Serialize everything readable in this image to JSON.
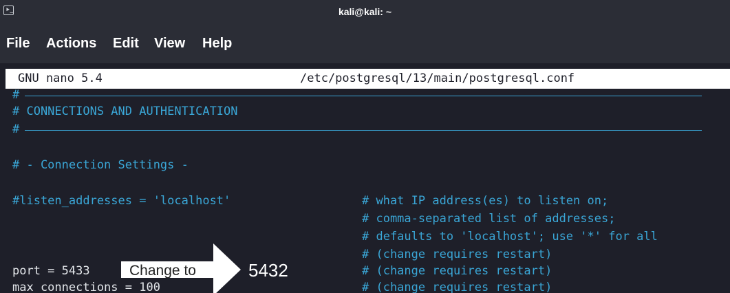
{
  "window": {
    "title": "kali@kali: ~",
    "icon": "terminal-icon",
    "icon_glyph": "⯈_"
  },
  "menu": {
    "items": [
      "File",
      "Actions",
      "Edit",
      "View",
      "Help"
    ]
  },
  "nano": {
    "version": "GNU nano 5.4",
    "file_path": "/etc/postgresql/13/main/postgresql.conf"
  },
  "lines": {
    "hash_top": "#",
    "section_title": "# CONNECTIONS AND AUTHENTICATION",
    "hash_bottom": "#",
    "subsection": "# - Connection Settings -",
    "listen_addresses": "#listen_addresses = 'localhost'",
    "comment_1": "# what IP address(es) to listen on;",
    "comment_2": "# comma-separated list of addresses;",
    "comment_3": "# defaults to 'localhost'; use '*' for all",
    "comment_4": "# (change requires restart)",
    "port": "port = 5433",
    "comment_5": "# (change requires restart)",
    "max_connections": "max_connections = 100",
    "comment_6": "# (change requires restart)"
  },
  "annotation": {
    "label": "Change to",
    "value": "5432"
  },
  "colors": {
    "background": "#1e1f29",
    "titlebar": "#2b2d36",
    "comment_blue": "#3aa6d6",
    "text": "#e3e6ea"
  }
}
